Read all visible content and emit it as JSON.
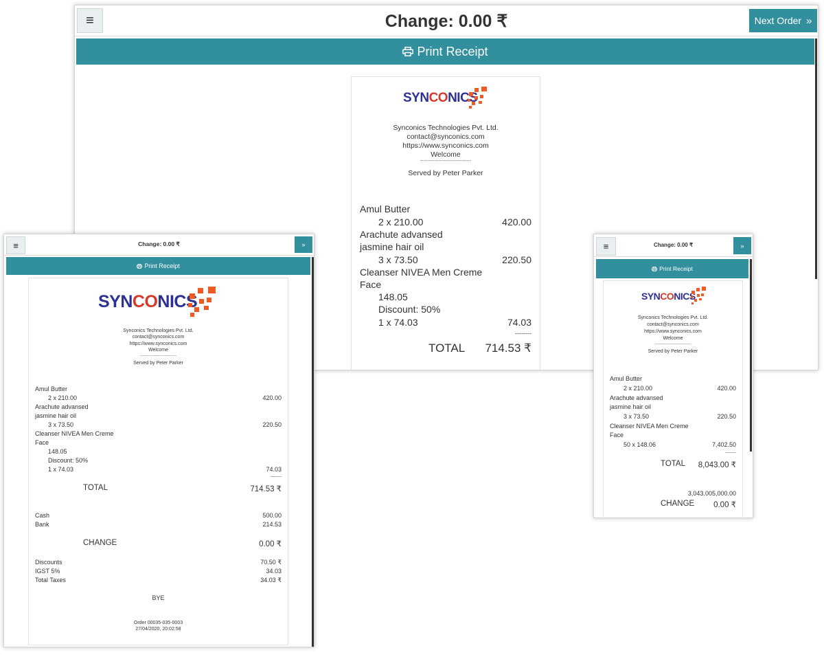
{
  "common": {
    "change_title": "Change: 0.00 ₹",
    "print_label": "Print Receipt",
    "next_label": "Next Order",
    "next_chevron": "»",
    "menu_glyph": "≡",
    "brand": {
      "syn": "SYN",
      "co": "CO",
      "nics": "NICS"
    },
    "company": "Synconics Technologies Pvt. Ltd.",
    "email": "contact@synconics.com",
    "website": "https://www.synconics.com",
    "welcome": "Welcome",
    "separator": "--------------------------------",
    "served_by": "Served by Peter Parker",
    "currency": "₹",
    "colors": {
      "accent": "#328f9e",
      "brand_blue": "#2e3192",
      "brand_orange": "#f15a24"
    }
  },
  "main": {
    "lines": [
      {
        "name": "Amul Butter",
        "detail": "2 x 210.00",
        "amount": "420.00"
      },
      {
        "name": "Arachute advansed",
        "name2": "jasmine hair oil",
        "detail": "3 x 73.50",
        "amount": "220.50"
      },
      {
        "name": "Cleanser NIVEA Men Creme",
        "name2": "Face",
        "price": "148.05",
        "discount": "Discount: 50%",
        "detail": "1 x 74.03",
        "amount": "74.03"
      }
    ],
    "dashes": "--------",
    "total_label": "TOTAL",
    "total_value": "714.53 ₹"
  },
  "left": {
    "lines": [
      {
        "name": "Amul Butter",
        "detail": "2 x 210.00",
        "amount": "420.00"
      },
      {
        "name": "Arachute advansed",
        "name2": "jasmine hair oil",
        "detail": "3 x 73.50",
        "amount": "220.50"
      },
      {
        "name": "Cleanser NIVEA Men Creme",
        "name2": "Face",
        "price": "148.05",
        "discount": "Discount: 50%",
        "detail": "1 x 74.03",
        "amount": "74.03"
      }
    ],
    "dashes": "--------",
    "total_label": "TOTAL",
    "total_value": "714.53 ₹",
    "payments": [
      {
        "label": "Cash",
        "value": "500.00"
      },
      {
        "label": "Bank",
        "value": "214.53"
      }
    ],
    "change_label": "CHANGE",
    "change_value": "0.00 ₹",
    "taxes": [
      {
        "label": "Discounts",
        "value": "70.50 ₹"
      },
      {
        "label": "IGST 5%",
        "value": "34.03"
      },
      {
        "label": "Total Taxes",
        "value": "34.03 ₹"
      }
    ],
    "footer": "BYE",
    "order": "Order 00035-035-0003",
    "datetime": "27/04/2020, 20:02:58"
  },
  "right": {
    "lines": [
      {
        "name": "Amul Butter",
        "detail": "2 x 210.00",
        "amount": "420.00"
      },
      {
        "name": "Arachute advansed",
        "name2": "jasmine hair oil",
        "detail": "3 x 73.50",
        "amount": "220.50"
      },
      {
        "name": "Cleanser NIVEA Men Creme",
        "name2": "Face",
        "detail": "50 x 148.06",
        "amount": "7,402.50"
      }
    ],
    "dashes": "--------",
    "total_label": "TOTAL",
    "total_value": "8,043.00 ₹",
    "paid_value": "3,043.005,000.00",
    "change_label": "CHANGE",
    "change_value": "0.00 ₹"
  }
}
